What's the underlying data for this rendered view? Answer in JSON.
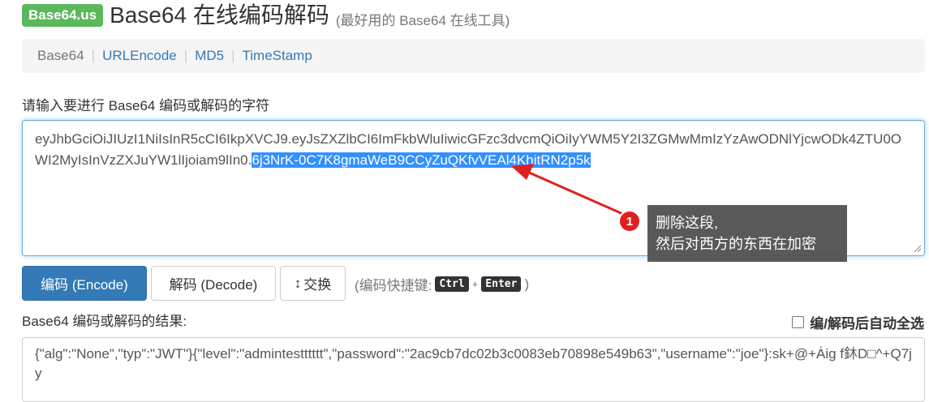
{
  "header": {
    "logo": "Base64.us",
    "title": "Base64 在线编码解码",
    "subtitle": "(最好用的 Base64 在线工具)"
  },
  "nav": {
    "items": [
      {
        "label": "Base64"
      },
      {
        "label": "URLEncode"
      },
      {
        "label": "MD5"
      },
      {
        "label": "TimeStamp"
      }
    ],
    "separator": "|"
  },
  "input": {
    "label": "请输入要进行 Base64 编码或解码的字符",
    "text_before": "eyJhbGciOiJIUzI1NiIsInR5cCI6IkpXVCJ9.eyJsZXZlbCI6ImFkbWluIiwicGFzc3dvcmQiOiIyYWM5Y2I3ZGMwMmIzYzAwODNlYjcwODk4ZTU0OWI2MyIsInVzZXJuYW1lIjoiam9lIn0.",
    "text_selected": "6j3NrK-0C7K8gmaWeB9CCyZuQKfvVEAl4KhitRN2p5k"
  },
  "annotation": {
    "number": "1",
    "line1": "删除这段,",
    "line2": "然后对西方的东西在加密",
    "color": "#e02020"
  },
  "buttons": {
    "encode": "编码 (Encode)",
    "decode": "解码 (Decode)",
    "swap_icon": "↕",
    "swap": "交换"
  },
  "shortcut": {
    "prefix": "(编码快捷键:",
    "key1": "Ctrl",
    "plus": "+",
    "key2": "Enter",
    "suffix": ")"
  },
  "result": {
    "label": "Base64 编码或解码的结果:",
    "auto_select": "编/解码后自动全选",
    "text": "{\"alg\":\"None\",\"typ\":\"JWT\"}{\"level\":\"admintestttttt\",\"password\":\"2ac9cb7dc02b3c0083eb70898e549b63\",\"username\":\"joe\"}:sk+@+Ȧig f鈢D□^+Q7jy"
  }
}
